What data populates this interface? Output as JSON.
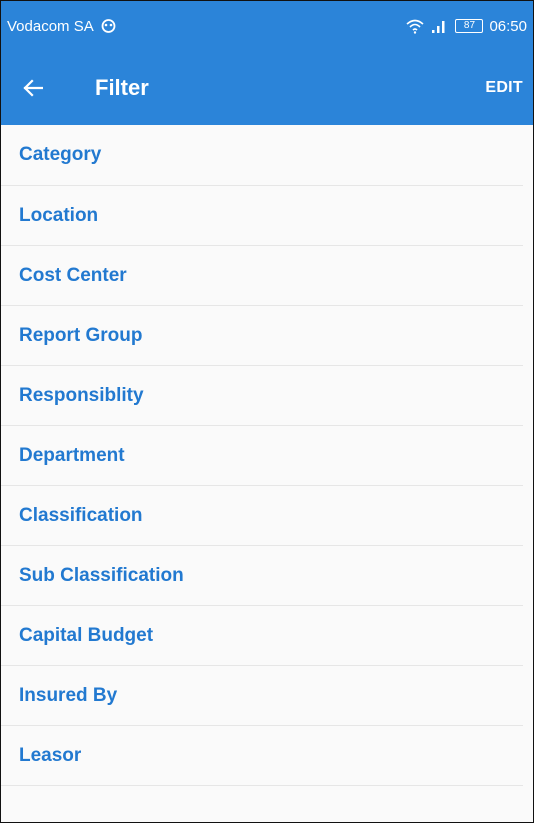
{
  "status_bar": {
    "carrier": "Vodacom SA",
    "battery": "87",
    "time": "06:50",
    "icons": [
      "notification-icon",
      "wifi-icon",
      "signal-icon",
      "battery-icon"
    ]
  },
  "app_bar": {
    "title": "Filter",
    "edit_label": "EDIT",
    "back_icon": "arrow-left-icon"
  },
  "filter_items": [
    {
      "label": "Category"
    },
    {
      "label": "Location"
    },
    {
      "label": "Cost Center"
    },
    {
      "label": "Report Group"
    },
    {
      "label": "Responsiblity"
    },
    {
      "label": "Department"
    },
    {
      "label": "Classification"
    },
    {
      "label": "Sub Classification"
    },
    {
      "label": "Capital Budget"
    },
    {
      "label": "Insured By"
    },
    {
      "label": "Leasor"
    }
  ],
  "colors": {
    "primary": "#2b84d9",
    "item_text": "#2279d0",
    "background": "#fafafa",
    "divider": "#e6e6e6"
  }
}
